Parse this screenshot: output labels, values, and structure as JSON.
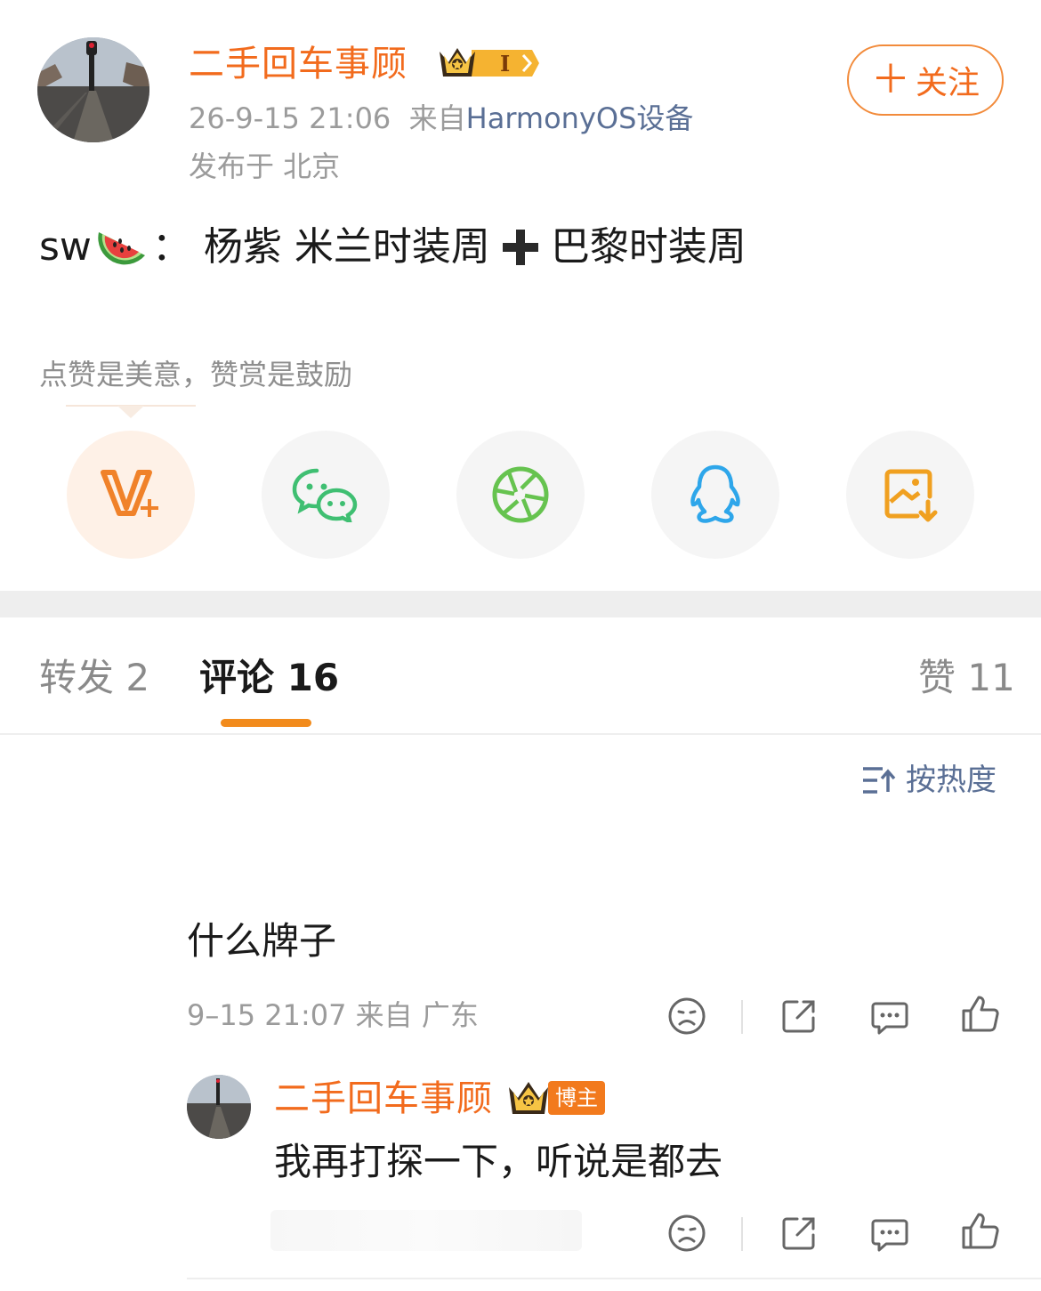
{
  "author": {
    "name": "二手回车事顾",
    "level_badge": "I",
    "time": "26-9-15 21:06",
    "source_prefix": "来自",
    "device": "HarmonyOS设备",
    "location": "发布于 北京",
    "follow_label": "关注"
  },
  "post": {
    "prefix": "sw",
    "colon": "：",
    "text_a": "杨紫 米兰时装周",
    "text_b": "巴黎时装周"
  },
  "reward_tip": "点赞是美意，赞赏是鼓励",
  "share": [
    {
      "name": "vplus-icon",
      "color": "#f0822a"
    },
    {
      "name": "wechat-icon",
      "color": "#3fbf72"
    },
    {
      "name": "moments-icon",
      "color": "#66c34f"
    },
    {
      "name": "qq-icon",
      "color": "#2ea6ea"
    },
    {
      "name": "save-image-icon",
      "color": "#f0a020"
    }
  ],
  "tabs": {
    "repost": "转发 2",
    "comment": "评论 16",
    "like": "赞 11"
  },
  "sort_label": "按热度",
  "comment": {
    "text": "什么牌子",
    "meta": "9–15 21:07  来自 广东"
  },
  "reply": {
    "name": "二手回车事顾",
    "tag": "博主",
    "text": "我再打探一下，听说是都去"
  }
}
